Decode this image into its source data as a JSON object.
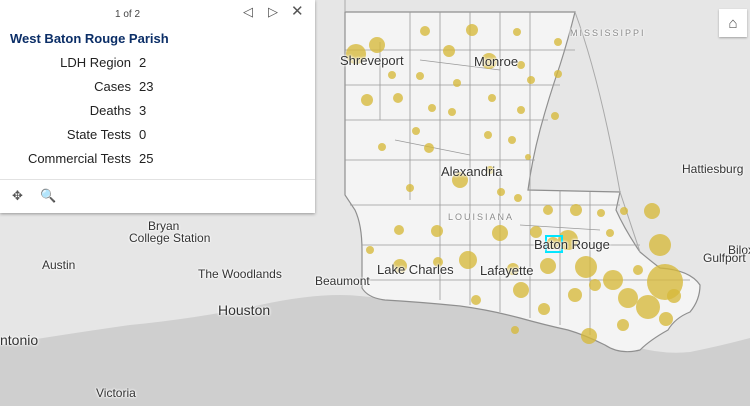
{
  "popup": {
    "pager": "1 of 2",
    "title": "West Baton Rouge Parish",
    "fields": [
      {
        "label": "LDH Region",
        "value": "2"
      },
      {
        "label": "Cases",
        "value": "23"
      },
      {
        "label": "Deaths",
        "value": "3"
      },
      {
        "label": "State Tests",
        "value": "0"
      },
      {
        "label": "Commercial Tests",
        "value": "25"
      }
    ],
    "prev_icon": "triangle-left-icon",
    "next_icon": "triangle-right-icon",
    "close_icon": "close-icon",
    "pan_icon": "move-icon",
    "zoom_icon": "zoom-to-icon"
  },
  "home_icon": "home-icon",
  "map_labels": {
    "shreveport": "Shreveport",
    "monroe": "Monroe",
    "mississippi": "MISSISSIPPI",
    "alexandria": "Alexandria",
    "louisiana": "LOUISIANA",
    "hattiesburg": "Hattiesburg",
    "baton_rouge": "Baton Rouge",
    "bryan": "Bryan",
    "college_station": "College Station",
    "austin": "Austin",
    "woodlands": "The Woodlands",
    "beaumont": "Beaumont",
    "lake_charles": "Lake Charles",
    "lafayette": "Lafayette",
    "biloxi": "Bilox",
    "gulfport": "Gulfport",
    "houston": "Houston",
    "san_antonio": "ntonio",
    "victoria": "Victoria"
  },
  "colors": {
    "bubble": "#d6b93a",
    "highlight": "#00e5ff",
    "land": "#f3f3f3",
    "water": "#cfcfcf",
    "title": "#0b2e67"
  }
}
